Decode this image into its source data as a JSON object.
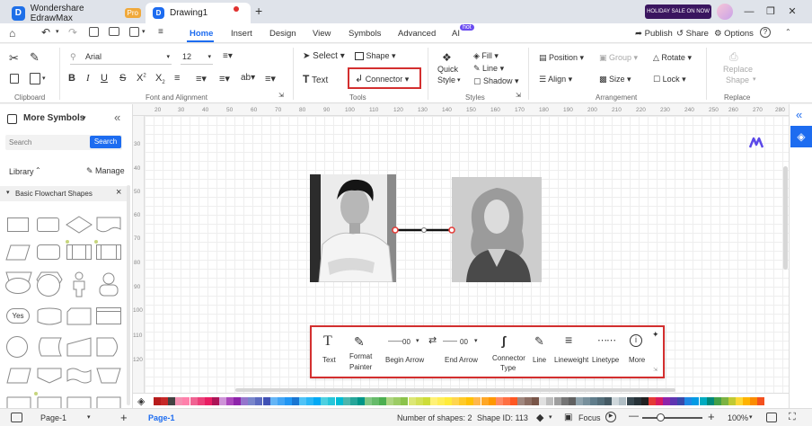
{
  "titlebar": {
    "app_name": "Wondershare EdrawMax",
    "pro_badge": "Pro",
    "doc_tab": "Drawing1",
    "add_tab": "+",
    "promo": "HOLIDAY SALE ON NOW"
  },
  "menu": {
    "home": "Home",
    "insert": "Insert",
    "design": "Design",
    "view": "View",
    "symbols": "Symbols",
    "advanced": "Advanced",
    "ai": "AI",
    "ai_badge": "hot",
    "publish": "Publish",
    "share": "Share",
    "options": "Options"
  },
  "ribbon": {
    "font_name": "Arial",
    "font_size": "12",
    "select": "Select",
    "shape": "Shape",
    "text": "Text",
    "connector": "Connector",
    "quick_style_1": "Quick",
    "quick_style_2": "Style",
    "fill": "Fill",
    "line": "Line",
    "shadow": "Shadow",
    "position": "Position",
    "group": "Group",
    "rotate": "Rotate",
    "align": "Align",
    "size": "Size",
    "lock": "Lock",
    "replace_shape_1": "Replace",
    "replace_shape_2": "Shape",
    "groups": {
      "clipboard": "Clipboard",
      "font": "Font and Alignment",
      "tools": "Tools",
      "styles": "Styles",
      "arrangement": "Arrangement",
      "replace": "Replace"
    }
  },
  "left_panel": {
    "title": "More Symbols",
    "search_placeholder": "Search",
    "search_button": "Search",
    "library": "Library",
    "manage": "Manage",
    "category": "Basic Flowchart Shapes",
    "yes_shape": "Yes"
  },
  "ruler": {
    "top": [
      "20",
      "30",
      "40",
      "50",
      "60",
      "70",
      "80",
      "90",
      "100",
      "110",
      "120",
      "130",
      "140",
      "150",
      "160",
      "170",
      "180",
      "190",
      "200",
      "210",
      "220",
      "230",
      "240",
      "250",
      "260",
      "270",
      "280"
    ],
    "left": [
      "30",
      "40",
      "50",
      "60",
      "70",
      "80",
      "90",
      "100",
      "110",
      "120"
    ]
  },
  "floating_toolbar": {
    "items": [
      {
        "label": "Text",
        "icon": "text-T-icon"
      },
      {
        "label": "Format Painter",
        "line1": "Format",
        "line2": "Painter",
        "icon": "format-painter-icon"
      },
      {
        "label": "Begin Arrow",
        "value": "00",
        "icon": "begin-arrow-icon"
      },
      {
        "label": "End Arrow",
        "value": "00",
        "icon": "end-arrow-icon"
      },
      {
        "label": "Connector Type",
        "line1": "Connector",
        "line2": "Type",
        "icon": "connector-type-icon"
      },
      {
        "label": "Line",
        "icon": "line-pen-icon"
      },
      {
        "label": "Lineweight",
        "icon": "lineweight-icon"
      },
      {
        "label": "Linetype",
        "icon": "linetype-icon"
      },
      {
        "label": "More",
        "icon": "more-icon"
      }
    ]
  },
  "palette_colors": [
    "#b71c1c",
    "#c62828",
    "#424242",
    "#f48fb1",
    "#ff80ab",
    "#f06292",
    "#ec407a",
    "#e91e63",
    "#ad1457",
    "#ce93d8",
    "#ab47bc",
    "#8e24aa",
    "#9575cd",
    "#7986cb",
    "#5c6bc0",
    "#3f51b5",
    "#64b5f6",
    "#42a5f5",
    "#2196f3",
    "#1976d2",
    "#4fc3f7",
    "#29b6f6",
    "#03a9f4",
    "#4dd0e1",
    "#26c6da",
    "#00bcd4",
    "#4db6ac",
    "#26a69a",
    "#009688",
    "#81c784",
    "#66bb6a",
    "#4caf50",
    "#aed581",
    "#9ccc65",
    "#8bc34a",
    "#dce775",
    "#d4e157",
    "#cddc39",
    "#fff176",
    "#ffee58",
    "#ffeb3b",
    "#ffd54f",
    "#ffca28",
    "#ffc107",
    "#ffb74d",
    "#ffa726",
    "#ff9800",
    "#ff8a65",
    "#ff7043",
    "#ff5722",
    "#a1887f",
    "#8d6e63",
    "#795548",
    "#e0e0e0",
    "#bdbdbd",
    "#9e9e9e",
    "#757575",
    "#616161",
    "#90a4ae",
    "#78909c",
    "#607d8b",
    "#546e7a",
    "#455a64",
    "#cfd8dc",
    "#b0bec5",
    "#37474f",
    "#263238",
    "#212121",
    "#e53935",
    "#d81b60",
    "#8e24aa",
    "#5e35b1",
    "#3949ab",
    "#1e88e5",
    "#039be5",
    "#00acc1",
    "#00897b",
    "#43a047",
    "#7cb342",
    "#c0ca33",
    "#fdd835",
    "#ffb300",
    "#fb8c00",
    "#f4511e"
  ],
  "status": {
    "page_tab": "Page-1",
    "active_page": "Page-1",
    "add_page": "+",
    "shapes": "Number of shapes: 2",
    "shape_id": "Shape ID: 113",
    "focus": "Focus",
    "zoom": "100%"
  },
  "colors": {
    "accent": "#1d6cf0",
    "highlight": "#d32f2f"
  }
}
